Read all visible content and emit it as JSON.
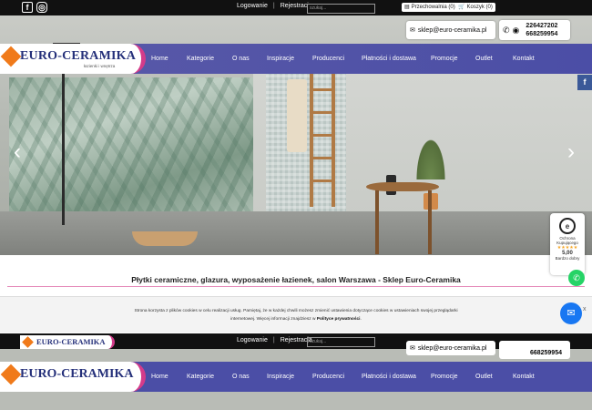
{
  "top": {
    "login": "Logowanie",
    "register": "Rejestracja",
    "search_placeholder": "szukaj...",
    "storage": "Przechowalnia (0)",
    "cart": "Koszyk (0)"
  },
  "contact": {
    "email": "sklep@euro-ceramika.pl",
    "phone1": "226427202",
    "phone2": "668259954"
  },
  "brand": {
    "name": "EURO-CERAMIKA",
    "tagline": "łazienki i wnętrza"
  },
  "nav": [
    "Home",
    "Kategorie",
    "O nas",
    "Inspiracje",
    "Producenci",
    "Płatności i dostawa",
    "Promocje",
    "Outlet",
    "Kontakt"
  ],
  "slider": {
    "prev": "‹",
    "next": "›"
  },
  "headline": "Płytki ceramiczne, glazura, wyposażenie łazienek, salon Warszawa - Sklep Euro-Ceramika",
  "trust": {
    "title": "Ochrona Kupującego",
    "stars": "★★★★★",
    "score": "5,00",
    "label": "Bardzo dobry"
  },
  "cookie": {
    "line1": "Strona korzysta z plików cookies w celu realizacji usług. Pamiętaj, że w każdej chwili możesz zmienić ustawienia dotyczące cookies w ustawieniach swojej przeglądarki",
    "line2_prefix": "internetowej. Więcej informacji znajdziesz w ",
    "policy_link": "Polityce prywatności",
    "line2_suffix": ".",
    "close": "x"
  },
  "colors": {
    "nav_bg": "#4b4ea6",
    "accent": "#d43b8a",
    "logo_orange": "#f07a1a",
    "logo_text": "#25307a"
  }
}
